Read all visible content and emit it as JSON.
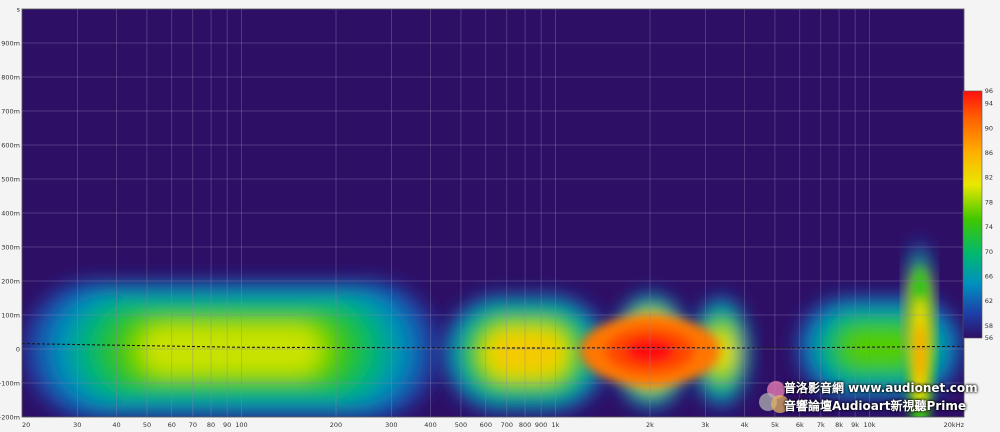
{
  "chart_data": {
    "type": "heatmap",
    "title": "",
    "xlabel": "",
    "ylabel": "",
    "x_scale": "log",
    "xlim": [
      20,
      20000
    ],
    "x_ticks": [
      {
        "value": 20,
        "label": "20"
      },
      {
        "value": 30,
        "label": "30"
      },
      {
        "value": 40,
        "label": "40"
      },
      {
        "value": 50,
        "label": "50"
      },
      {
        "value": 60,
        "label": "60"
      },
      {
        "value": 70,
        "label": "70"
      },
      {
        "value": 80,
        "label": "80"
      },
      {
        "value": 90,
        "label": "90"
      },
      {
        "value": 100,
        "label": "100"
      },
      {
        "value": 200,
        "label": "200"
      },
      {
        "value": 300,
        "label": "300"
      },
      {
        "value": 400,
        "label": "400"
      },
      {
        "value": 500,
        "label": "500"
      },
      {
        "value": 600,
        "label": "600"
      },
      {
        "value": 700,
        "label": "700"
      },
      {
        "value": 800,
        "label": "800"
      },
      {
        "value": 900,
        "label": "900"
      },
      {
        "value": 1000,
        "label": "1k"
      },
      {
        "value": 2000,
        "label": "2k"
      },
      {
        "value": 3000,
        "label": "3k"
      },
      {
        "value": 4000,
        "label": "4k"
      },
      {
        "value": 5000,
        "label": "5k"
      },
      {
        "value": 6000,
        "label": "6k"
      },
      {
        "value": 7000,
        "label": "7k"
      },
      {
        "value": 8000,
        "label": "8k"
      },
      {
        "value": 9000,
        "label": "9k"
      },
      {
        "value": 10000,
        "label": "10k"
      },
      {
        "value": 20000,
        "label": "20kHz"
      }
    ],
    "ylim": [
      -200,
      1000
    ],
    "y_ticks": [
      {
        "value": 1000,
        "label": "s"
      },
      {
        "value": 900,
        "label": "900m"
      },
      {
        "value": 800,
        "label": "800m"
      },
      {
        "value": 700,
        "label": "700m"
      },
      {
        "value": 600,
        "label": "600m"
      },
      {
        "value": 500,
        "label": "500m"
      },
      {
        "value": 400,
        "label": "400m"
      },
      {
        "value": 300,
        "label": "300m"
      },
      {
        "value": 200,
        "label": "200m"
      },
      {
        "value": 100,
        "label": "100m"
      },
      {
        "value": 0,
        "label": "0"
      },
      {
        "value": -100,
        "label": "-100m"
      },
      {
        "value": -200,
        "label": "-200m"
      }
    ],
    "grid": true,
    "colorbar": {
      "range": [
        56,
        96
      ],
      "ticks": [
        "96",
        "94",
        "90",
        "86",
        "82",
        "78",
        "74",
        "70",
        "66",
        "62",
        "58",
        "56"
      ]
    },
    "blobs": [
      {
        "f_min": 20,
        "f_max": 430,
        "t_min": -210,
        "t_max": 205,
        "peak_level": 80
      },
      {
        "f_min": 430,
        "f_max": 1500,
        "t_min": -190,
        "t_max": 165,
        "peak_level": 84
      },
      {
        "f_min": 1500,
        "f_max": 2700,
        "t_min": -180,
        "t_max": 170,
        "peak_level": 96
      },
      {
        "f_min": 2700,
        "f_max": 4200,
        "t_min": -175,
        "t_max": 160,
        "peak_level": 82
      },
      {
        "f_min": 5800,
        "f_max": 20000,
        "t_min": -150,
        "t_max": 160,
        "peak_level": 76
      },
      {
        "f_min": 13000,
        "f_max": 16000,
        "t_min": -150,
        "t_max": 320,
        "peak_level": 90
      }
    ],
    "dashed_line": {
      "x": [
        20,
        100,
        1000,
        2000,
        5000,
        20000
      ],
      "y": [
        16,
        5,
        3,
        4,
        3,
        8
      ]
    }
  },
  "watermark": {
    "line1": "普洛影音網 www.audionet.com",
    "line2": "音響論壇Audioart新視聽Prime"
  },
  "colors": {
    "background": "#2e0f66",
    "grid": "#8a83b0"
  }
}
